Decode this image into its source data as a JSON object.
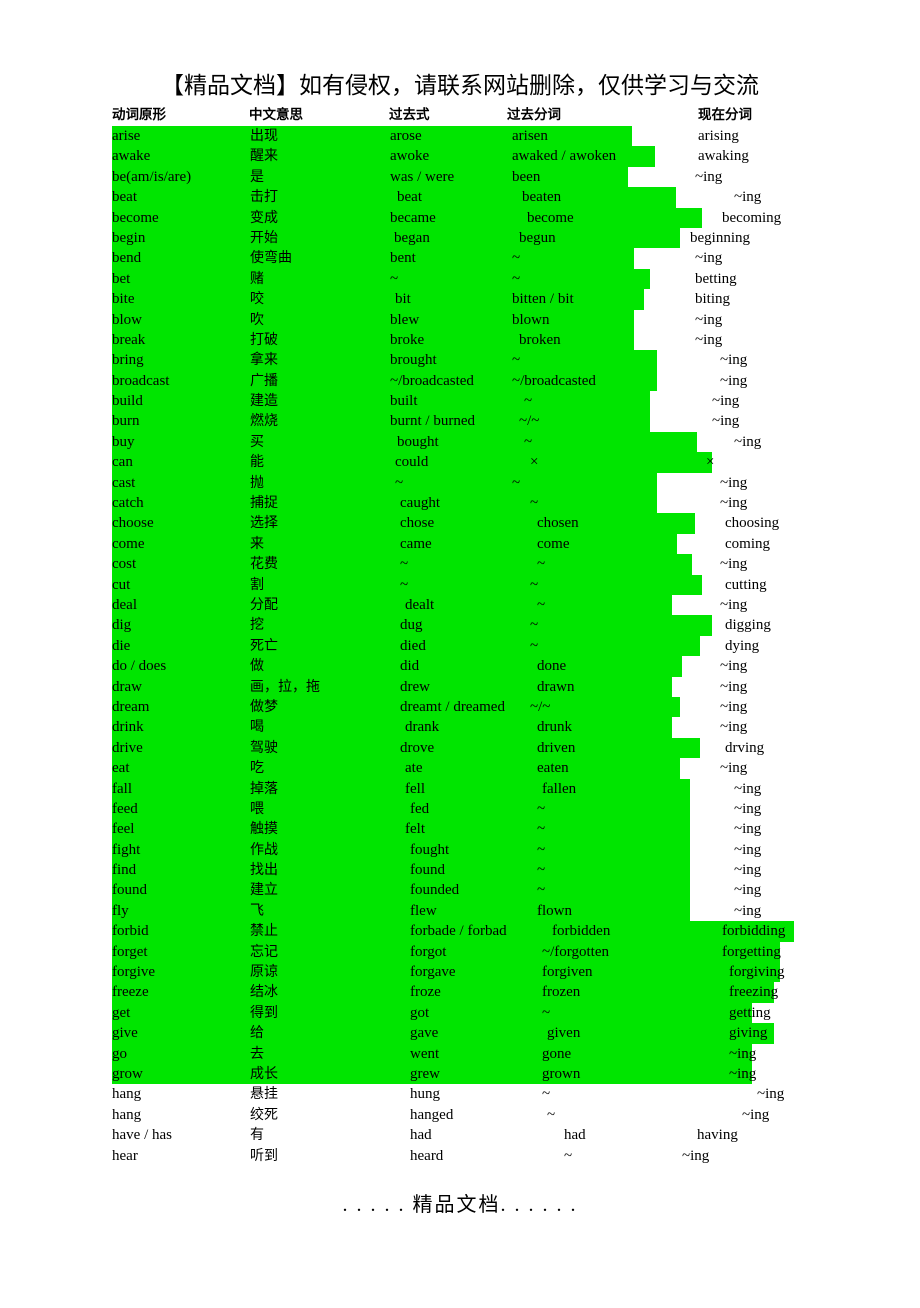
{
  "banner": {
    "text": "【精品文档】如有侵权，请联系网站删除，仅供学习与交流"
  },
  "footer": {
    "text": ". . . . . 精品文档. . . . . ."
  },
  "colors": {
    "highlight": "#00e500",
    "text": "#000000",
    "page_background": "#ffffff"
  },
  "table": {
    "headers": [
      "动词原形",
      "中文意思",
      "过去式",
      "过去分词",
      "现在分词"
    ],
    "column_offsets": [
      0,
      137,
      277,
      395,
      586
    ],
    "rows": [
      {
        "base": "arise",
        "cn": "出现",
        "past": "arose",
        "pp": "arisen",
        "ing": "arising",
        "hl": true,
        "hlw": 520,
        "off": [
          0,
          138,
          278,
          400,
          586
        ]
      },
      {
        "base": "awake",
        "cn": "醒来",
        "past": "awoke",
        "pp": "awaked / awoken",
        "ing": "awaking",
        "hl": true,
        "hlw": 543,
        "off": [
          0,
          138,
          278,
          400,
          586
        ]
      },
      {
        "base": "be(am/is/are)",
        "cn": "是",
        "past": "was / were",
        "pp": "been",
        "ing": "~ing",
        "hl": true,
        "hlw": 516,
        "off": [
          0,
          138,
          278,
          400,
          583
        ]
      },
      {
        "base": "beat",
        "cn": "击打",
        "past": "beat",
        "pp": "beaten",
        "ing": "~ing",
        "hl": true,
        "hlw": 564,
        "off": [
          0,
          138,
          285,
          410,
          622
        ]
      },
      {
        "base": "become",
        "cn": "变成",
        "past": "became",
        "pp": "become",
        "ing": "becoming",
        "hl": true,
        "hlw": 590,
        "off": [
          0,
          138,
          278,
          415,
          610
        ]
      },
      {
        "base": "begin",
        "cn": "开始",
        "past": "began",
        "pp": "begun",
        "ing": "beginning",
        "hl": true,
        "hlw": 568,
        "off": [
          0,
          138,
          282,
          407,
          578
        ]
      },
      {
        "base": "bend",
        "cn": "使弯曲",
        "past": "bent",
        "pp": "~",
        "ing": "~ing",
        "hl": true,
        "hlw": 522,
        "off": [
          0,
          138,
          278,
          400,
          583
        ]
      },
      {
        "base": "bet",
        "cn": "赌",
        "past": "~",
        "pp": "~",
        "ing": "betting",
        "hl": true,
        "hlw": 538,
        "off": [
          0,
          138,
          278,
          400,
          583
        ]
      },
      {
        "base": "bite",
        "cn": "咬",
        "past": "bit",
        "pp": "bitten / bit",
        "ing": "biting",
        "hl": true,
        "hlw": 532,
        "off": [
          0,
          138,
          283,
          400,
          583
        ]
      },
      {
        "base": "blow",
        "cn": "吹",
        "past": "blew",
        "pp": "blown",
        "ing": "~ing",
        "hl": true,
        "hlw": 522,
        "off": [
          0,
          138,
          278,
          400,
          583
        ]
      },
      {
        "base": "break",
        "cn": "打破",
        "past": "broke",
        "pp": "broken",
        "ing": "~ing",
        "hl": true,
        "hlw": 522,
        "off": [
          0,
          138,
          278,
          407,
          583
        ]
      },
      {
        "base": "bring",
        "cn": "拿来",
        "past": "brought",
        "pp": "~",
        "ing": "~ing",
        "hl": true,
        "hlw": 545,
        "off": [
          0,
          138,
          278,
          400,
          608
        ]
      },
      {
        "base": "broadcast",
        "cn": "广播",
        "past": "~/broadcasted",
        "pp": "~/broadcasted",
        "ing": "~ing",
        "hl": true,
        "hlw": 545,
        "off": [
          0,
          138,
          278,
          400,
          608
        ]
      },
      {
        "base": "build",
        "cn": "建造",
        "past": "built",
        "pp": "~",
        "ing": "~ing",
        "hl": true,
        "hlw": 538,
        "off": [
          0,
          138,
          278,
          412,
          600
        ]
      },
      {
        "base": "burn",
        "cn": "燃烧",
        "past": "burnt / burned",
        "pp": "~/~",
        "ing": "~ing",
        "hl": true,
        "hlw": 538,
        "off": [
          0,
          138,
          278,
          407,
          600
        ]
      },
      {
        "base": "buy",
        "cn": "买",
        "past": "bought",
        "pp": "~",
        "ing": "~ing",
        "hl": true,
        "hlw": 585,
        "off": [
          0,
          138,
          285,
          412,
          622
        ]
      },
      {
        "base": "can",
        "cn": "能",
        "past": "could",
        "pp": "×",
        "ing": "×",
        "hl": true,
        "hlw": 600,
        "off": [
          0,
          138,
          283,
          418,
          594
        ]
      },
      {
        "base": "cast",
        "cn": "抛",
        "past": "~",
        "pp": "~",
        "ing": "~ing",
        "hl": true,
        "hlw": 545,
        "off": [
          0,
          138,
          283,
          400,
          608
        ]
      },
      {
        "base": "catch",
        "cn": "捕捉",
        "past": "caught",
        "pp": "~",
        "ing": "~ing",
        "hl": true,
        "hlw": 545,
        "off": [
          0,
          138,
          288,
          418,
          608
        ]
      },
      {
        "base": "choose",
        "cn": "选择",
        "past": "chose",
        "pp": "chosen",
        "ing": "choosing",
        "hl": true,
        "hlw": 583,
        "off": [
          0,
          138,
          288,
          425,
          613
        ]
      },
      {
        "base": "come",
        "cn": "来",
        "past": "came",
        "pp": "come",
        "ing": "coming",
        "hl": true,
        "hlw": 565,
        "off": [
          0,
          138,
          288,
          425,
          613
        ]
      },
      {
        "base": "cost",
        "cn": "花费",
        "past": "~",
        "pp": "~",
        "ing": "~ing",
        "hl": true,
        "hlw": 580,
        "off": [
          0,
          138,
          288,
          425,
          608
        ]
      },
      {
        "base": "cut",
        "cn": "割",
        "past": "~",
        "pp": "~",
        "ing": "cutting",
        "hl": true,
        "hlw": 590,
        "off": [
          0,
          138,
          288,
          418,
          613
        ]
      },
      {
        "base": "deal",
        "cn": "分配",
        "past": "dealt",
        "pp": "~",
        "ing": "~ing",
        "hl": true,
        "hlw": 560,
        "off": [
          0,
          138,
          293,
          425,
          608
        ]
      },
      {
        "base": "dig",
        "cn": "挖",
        "past": "dug",
        "pp": "~",
        "ing": "digging",
        "hl": true,
        "hlw": 600,
        "off": [
          0,
          138,
          288,
          418,
          613
        ]
      },
      {
        "base": "die",
        "cn": "死亡",
        "past": "died",
        "pp": "~",
        "ing": "dying",
        "hl": true,
        "hlw": 588,
        "off": [
          0,
          138,
          288,
          418,
          613
        ]
      },
      {
        "base": "do / does",
        "cn": "做",
        "past": "did",
        "pp": "done",
        "ing": "~ing",
        "hl": true,
        "hlw": 570,
        "off": [
          0,
          138,
          288,
          425,
          608
        ]
      },
      {
        "base": "draw",
        "cn": "画，拉，拖",
        "past": "drew",
        "pp": "drawn",
        "ing": "~ing",
        "hl": true,
        "hlw": 560,
        "off": [
          0,
          138,
          288,
          425,
          608
        ]
      },
      {
        "base": "dream",
        "cn": "做梦",
        "past": "dreamt / dreamed",
        "pp": "~/~",
        "ing": "~ing",
        "hl": true,
        "hlw": 568,
        "off": [
          0,
          138,
          288,
          418,
          608
        ]
      },
      {
        "base": "drink",
        "cn": "喝",
        "past": "drank",
        "pp": "drunk",
        "ing": "~ing",
        "hl": true,
        "hlw": 560,
        "off": [
          0,
          138,
          293,
          425,
          608
        ]
      },
      {
        "base": "drive",
        "cn": "驾驶",
        "past": "drove",
        "pp": "driven",
        "ing": "drving",
        "hl": true,
        "hlw": 588,
        "off": [
          0,
          138,
          288,
          425,
          613
        ]
      },
      {
        "base": "eat",
        "cn": "吃",
        "past": "ate",
        "pp": "eaten",
        "ing": "~ing",
        "hl": true,
        "hlw": 568,
        "off": [
          0,
          138,
          293,
          425,
          608
        ]
      },
      {
        "base": "fall",
        "cn": "掉落",
        "past": "fell",
        "pp": "fallen",
        "ing": "~ing",
        "hl": true,
        "hlw": 578,
        "off": [
          0,
          138,
          293,
          430,
          622
        ]
      },
      {
        "base": "feed",
        "cn": "喂",
        "past": "fed",
        "pp": "~",
        "ing": "~ing",
        "hl": true,
        "hlw": 578,
        "off": [
          0,
          138,
          298,
          425,
          622
        ]
      },
      {
        "base": "feel",
        "cn": "触摸",
        "past": "felt",
        "pp": "~",
        "ing": "~ing",
        "hl": true,
        "hlw": 578,
        "off": [
          0,
          138,
          293,
          425,
          622
        ]
      },
      {
        "base": "fight",
        "cn": "作战",
        "past": "fought",
        "pp": "~",
        "ing": "~ing",
        "hl": true,
        "hlw": 578,
        "off": [
          0,
          138,
          298,
          425,
          622
        ]
      },
      {
        "base": "find",
        "cn": "找出",
        "past": "found",
        "pp": "~",
        "ing": "~ing",
        "hl": true,
        "hlw": 578,
        "off": [
          0,
          138,
          298,
          425,
          622
        ]
      },
      {
        "base": "found",
        "cn": "建立",
        "past": "founded",
        "pp": "~",
        "ing": "~ing",
        "hl": true,
        "hlw": 578,
        "off": [
          0,
          138,
          298,
          425,
          622
        ]
      },
      {
        "base": "fly",
        "cn": "飞",
        "past": "flew",
        "pp": "flown",
        "ing": "~ing",
        "hl": true,
        "hlw": 578,
        "off": [
          0,
          138,
          298,
          425,
          622
        ]
      },
      {
        "base": "forbid",
        "cn": "禁止",
        "past": "forbade / forbad",
        "pp": "forbidden",
        "ing": "forbidding",
        "hl": true,
        "hlw": 682,
        "off": [
          0,
          138,
          298,
          440,
          610
        ]
      },
      {
        "base": "forget",
        "cn": "忘记",
        "past": "forgot",
        "pp": "~/forgotten",
        "ing": "forgetting",
        "hl": true,
        "hlw": 668,
        "off": [
          0,
          138,
          298,
          430,
          610
        ]
      },
      {
        "base": "forgive",
        "cn": "原谅",
        "past": "forgave",
        "pp": "forgiven",
        "ing": "forgiving",
        "hl": true,
        "hlw": 668,
        "off": [
          0,
          138,
          298,
          430,
          617
        ]
      },
      {
        "base": "freeze",
        "cn": "结冰",
        "past": "froze",
        "pp": "frozen",
        "ing": "freezing",
        "hl": true,
        "hlw": 662,
        "off": [
          0,
          138,
          298,
          430,
          617
        ]
      },
      {
        "base": "get",
        "cn": "得到",
        "past": "got",
        "pp": "~",
        "ing": "getting",
        "hl": true,
        "hlw": 640,
        "off": [
          0,
          138,
          298,
          430,
          617
        ]
      },
      {
        "base": "give",
        "cn": "给",
        "past": "gave",
        "pp": "given",
        "ing": "giving",
        "hl": true,
        "hlw": 662,
        "off": [
          0,
          138,
          298,
          435,
          617
        ]
      },
      {
        "base": "go",
        "cn": "去",
        "past": "went",
        "pp": "gone",
        "ing": "~ing",
        "hl": true,
        "hlw": 640,
        "off": [
          0,
          138,
          298,
          430,
          617
        ]
      },
      {
        "base": "grow",
        "cn": "成长",
        "past": "grew",
        "pp": "grown",
        "ing": "~ing",
        "hl": true,
        "hlw": 640,
        "off": [
          0,
          138,
          298,
          430,
          617
        ]
      },
      {
        "base": "hang",
        "cn": "悬挂",
        "past": "hung",
        "pp": "~",
        "ing": "~ing",
        "hl": false,
        "hlw": 0,
        "off": [
          0,
          138,
          298,
          430,
          645
        ]
      },
      {
        "base": "hang",
        "cn": "绞死",
        "past": "hanged",
        "pp": "~",
        "ing": "~ing",
        "hl": false,
        "hlw": 0,
        "off": [
          0,
          138,
          298,
          435,
          630
        ]
      },
      {
        "base": "have / has",
        "cn": "有",
        "past": "had",
        "pp": "had",
        "ing": "having",
        "hl": false,
        "hlw": 0,
        "off": [
          0,
          138,
          298,
          452,
          585
        ]
      },
      {
        "base": "hear",
        "cn": "听到",
        "past": "heard",
        "pp": "~",
        "ing": "~ing",
        "hl": false,
        "hlw": 0,
        "off": [
          0,
          138,
          298,
          452,
          570
        ]
      }
    ]
  }
}
